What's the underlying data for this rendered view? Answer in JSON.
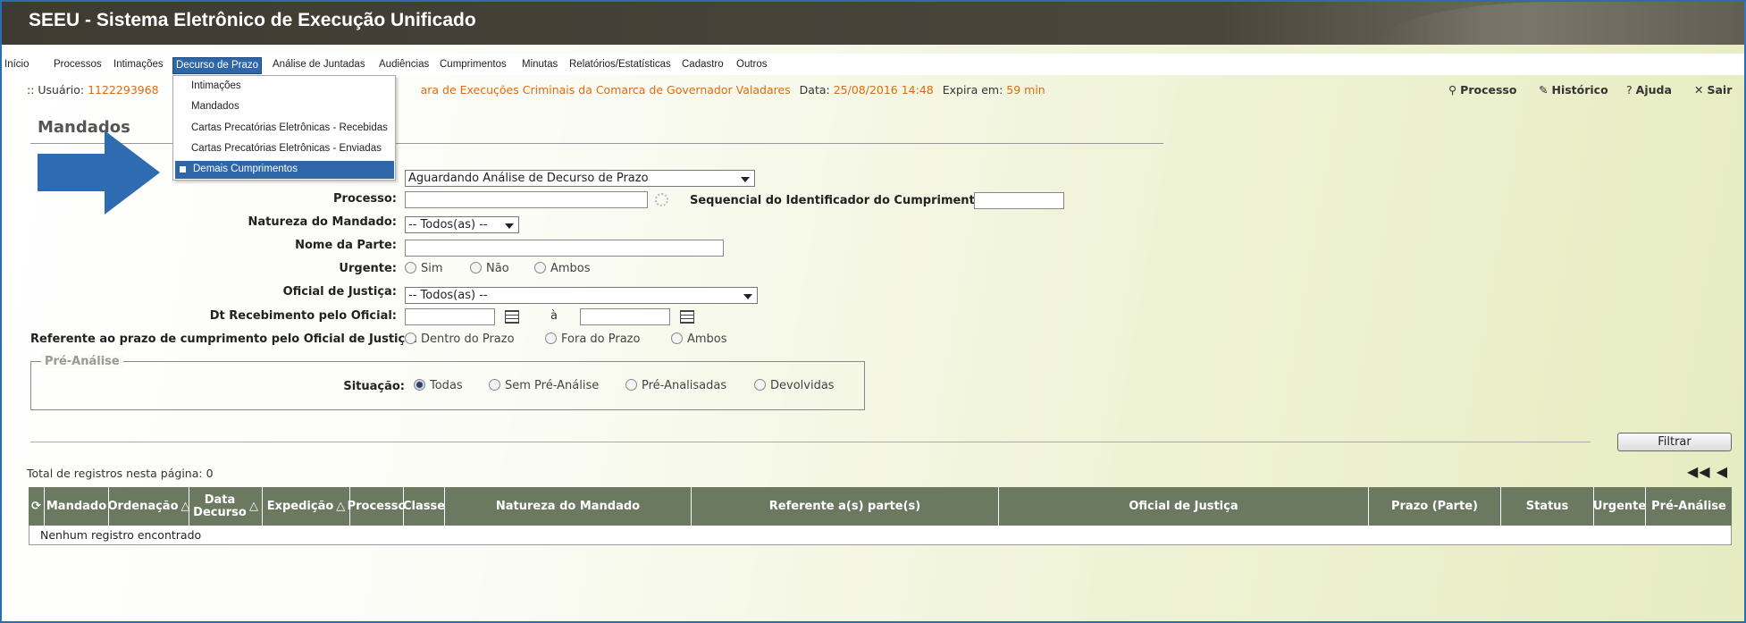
{
  "app": {
    "title": "SEEU - Sistema Eletrônico de Execução Unificado"
  },
  "menu": {
    "items": [
      "Início",
      "Processos",
      "Intimações",
      "Decurso de Prazo",
      "Análise de Juntadas",
      "Audiências",
      "Cumprimentos",
      "Minutas",
      "Relatórios/Estatísticas",
      "Cadastro",
      "Outros"
    ],
    "active": "Decurso de Prazo"
  },
  "dropdown": {
    "items": [
      "Intimações",
      "Mandados",
      "Cartas Precatórias Eletrônicas - Recebidas",
      "Cartas Precatórias Eletrônicas - Enviadas",
      "Demais Cumprimentos"
    ],
    "selected": "Demais Cumprimentos"
  },
  "userbar": {
    "user_label": ":: Usuário:",
    "user_value": "1122293968",
    "org_value": "ara de Execuções Criminais da Comarca de Governador Valadares",
    "date_label": "Data:",
    "date_value": "25/08/2016 14:48",
    "expires_label": "Expira em:",
    "expires_value": "59 min"
  },
  "toplinks": {
    "processo": "Processo",
    "historico": "Histórico",
    "ajuda": "Ajuda",
    "sair": "Sair"
  },
  "section": {
    "title": "Mandados"
  },
  "form": {
    "status_select": "Aguardando Análise de Decurso de Prazo",
    "processo_label": "Processo:",
    "processo_value": "",
    "sequencial_label": "Sequencial do Identificador do Cumprimento:",
    "sequencial_value": "",
    "natureza_label": "Natureza do Mandado:",
    "natureza_value": "-- Todos(as) --",
    "nome_label": "Nome da Parte:",
    "nome_value": "",
    "urgente_label": "Urgente:",
    "urgente_options": [
      "Sim",
      "Não",
      "Ambos"
    ],
    "oficial_label": "Oficial de Justiça:",
    "oficial_value": "-- Todos(as) --",
    "dt_label": "Dt Recebimento pelo Oficial:",
    "dt_sep": "à",
    "dt_from": "",
    "dt_to": "",
    "prazo_label": "Referente ao prazo de cumprimento pelo Oficial de Justiça:",
    "prazo_options": [
      "Dentro do Prazo",
      "Fora do Prazo",
      "Ambos"
    ]
  },
  "pre_analise": {
    "legend": "Pré-Análise",
    "situacao_label": "Situação:",
    "options": [
      "Todas",
      "Sem Pré-Análise",
      "Pré-Analisadas",
      "Devolvidas"
    ],
    "selected": "Todas"
  },
  "filter_button": "Filtrar",
  "results": {
    "total_label": "Total de registros nesta página: 0",
    "pager_first": "◀◀",
    "pager_prev": "◀",
    "columns": [
      "Mandado",
      "Ordenação",
      "Data Decurso",
      "Expedição",
      "Processo",
      "Classe",
      "Natureza do Mandado",
      "Referente a(s) parte(s)",
      "Oficial de Justiça",
      "Prazo (Parte)",
      "Status",
      "Urgente",
      "Pré-Análise"
    ],
    "empty_message": "Nenhum registro encontrado"
  },
  "colors": {
    "titlebar": "#4a4539",
    "menu_active": "#2f66a8",
    "accent_orange": "#e06a10",
    "table_header": "#6b7961",
    "arrow": "#2f6bb0"
  }
}
